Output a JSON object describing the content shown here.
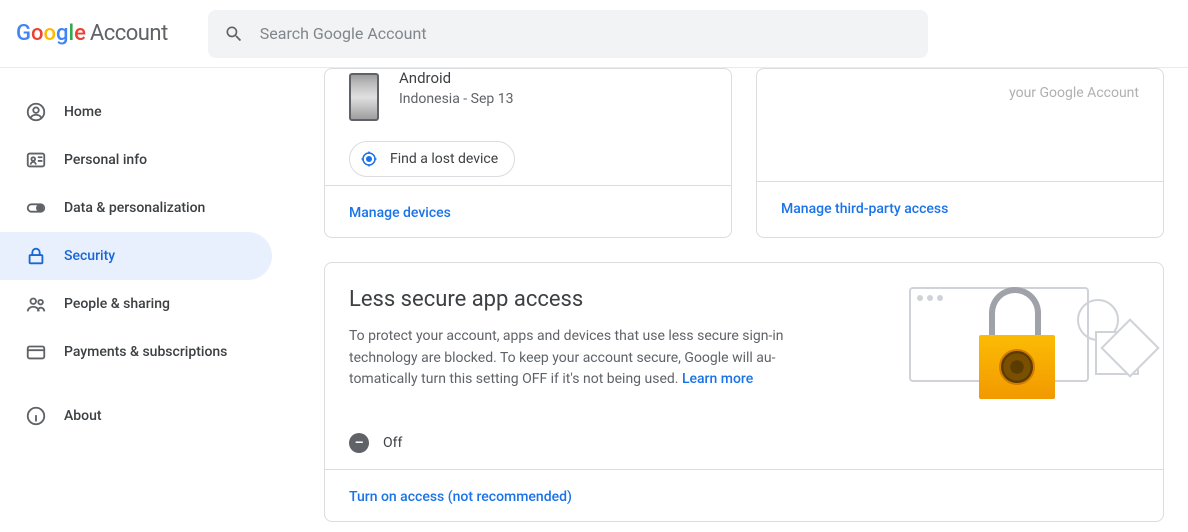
{
  "header": {
    "logo_product": "Account",
    "search_placeholder": "Search Google Account"
  },
  "sidebar": {
    "items": [
      {
        "label": "Home"
      },
      {
        "label": "Personal info"
      },
      {
        "label": "Data & personalization"
      },
      {
        "label": "Security"
      },
      {
        "label": "People & sharing"
      },
      {
        "label": "Payments & subscriptions"
      },
      {
        "label": "About"
      }
    ]
  },
  "devices": {
    "item": {
      "name": "Android",
      "meta": "Indonesia - Sep 13"
    },
    "chip_label": "Find a lost device",
    "manage_link": "Manage devices"
  },
  "third_party": {
    "hint_fragment": "your Google Account",
    "manage_link": "Manage third-party access"
  },
  "lsa": {
    "title": "Less secure app access",
    "desc": "To protect your account, apps and devices that use less secure sign-in technology are blocked. To keep your account secure, Google will au­tomatically turn this setting OFF if it's not being used. ",
    "learn_more": "Learn more",
    "status": "Off",
    "footer_link": "Turn on access (not recommended)"
  }
}
